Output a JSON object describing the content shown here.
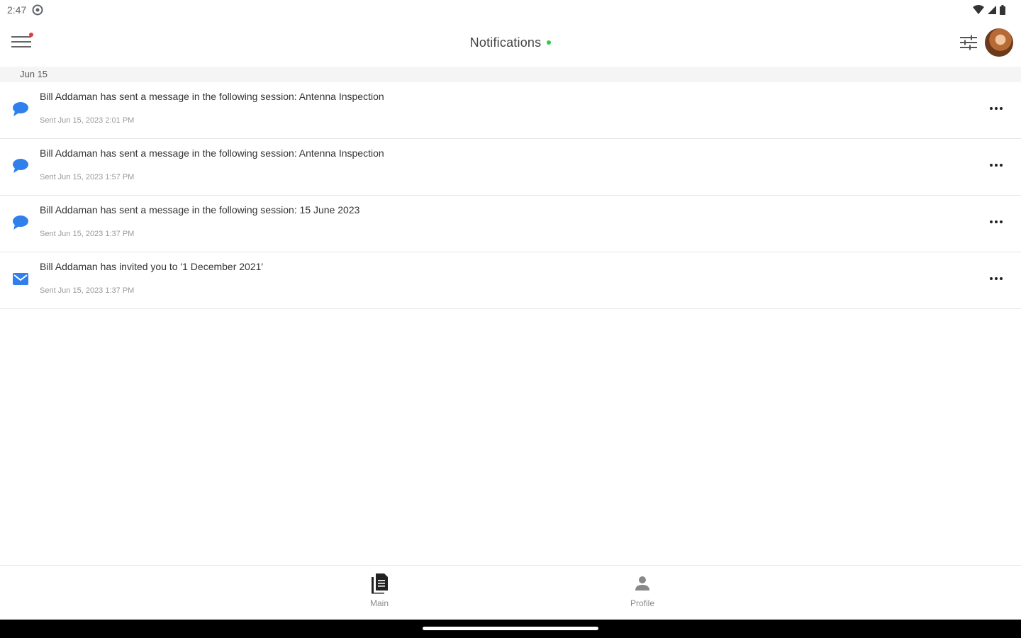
{
  "status_bar": {
    "time": "2:47",
    "icons": [
      "settings-gear-icon",
      "wifi-icon",
      "signal-icon",
      "battery-icon"
    ]
  },
  "app_bar": {
    "title": "Notifications",
    "online_indicator_color": "#2ecc40",
    "menu_badge_color": "#e53935",
    "icons": [
      "menu-icon",
      "filter-icon",
      "avatar"
    ]
  },
  "date_group": "Jun 15",
  "notifications": [
    {
      "icon": "chat-bubble-icon",
      "message": "Bill Addaman has sent a message in the following session: Antenna Inspection",
      "time": "Sent Jun 15, 2023 2:01 PM"
    },
    {
      "icon": "chat-bubble-icon",
      "message": "Bill Addaman has sent a message in the following session: Antenna Inspection",
      "time": "Sent Jun 15, 2023 1:57 PM"
    },
    {
      "icon": "chat-bubble-icon",
      "message": "Bill Addaman has sent a message in the following session: 15 June 2023",
      "time": "Sent Jun 15, 2023 1:37 PM"
    },
    {
      "icon": "envelope-icon",
      "message": "Bill Addaman has invited you to '1 December 2021'",
      "time": "Sent Jun 15, 2023 1:37 PM"
    }
  ],
  "bottom_nav": {
    "items": [
      {
        "label": "Main",
        "icon": "document-icon"
      },
      {
        "label": "Profile",
        "icon": "person-icon"
      }
    ]
  },
  "accent_color": "#2f80ed"
}
